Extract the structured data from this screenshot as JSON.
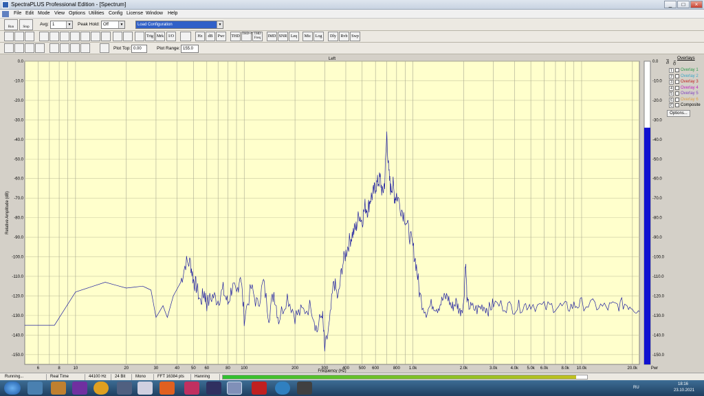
{
  "window": {
    "title": "SpectraPLUS Professional Edition - [Spectrum]",
    "minimize": "_",
    "maximize": "□",
    "close": "×"
  },
  "menu": [
    "File",
    "Edit",
    "Mode",
    "View",
    "Options",
    "Utilities",
    "Config",
    "License",
    "Window",
    "Help"
  ],
  "toolbar1": {
    "run": "Run",
    "stop": "Stop",
    "avg_label": "Avg:",
    "avg_value": "1",
    "peakhold_label": "Peak Hold:",
    "peakhold_value": "Off",
    "config_value": "Load Configuration"
  },
  "toolbar2": [
    "Trig",
    "Mrk",
    "I/O",
    "Hz",
    "dB",
    "Pwr",
    "THD",
    "THD+N",
    "THD Freq",
    "IMD",
    "SNR",
    "Leq",
    "Mic",
    "Log",
    "Dly",
    "Rvb",
    "Swp"
  ],
  "toolbar3": {
    "plottop_label": "Plot Top:",
    "plottop_value": "0.00",
    "plotrange_label": "Plot Range:",
    "plotrange_value": "155.0"
  },
  "plot": {
    "channel": "Left",
    "xlabel": "Frequency (Hz)",
    "ylabel": "Relative Amplitude (dB)"
  },
  "chart_data": {
    "type": "line",
    "title": "Left",
    "xlabel": "Frequency (Hz)",
    "ylabel": "Relative Amplitude (dB)",
    "xscale": "log",
    "xlim": [
      5,
      22000
    ],
    "ylim": [
      -155,
      0
    ],
    "grid": true,
    "yticks": [
      "0.0",
      "-10.0",
      "-20.0",
      "-30.0",
      "-40.0",
      "-50.0",
      "-60.0",
      "-70.0",
      "-80.0",
      "-90.0",
      "-100.0",
      "-110.0",
      "-120.0",
      "-130.0",
      "-140.0",
      "-150.0"
    ],
    "xticks": [
      {
        "v": 6,
        "t": "6"
      },
      {
        "v": 8,
        "t": "8"
      },
      {
        "v": 10,
        "t": "10"
      },
      {
        "v": 20,
        "t": "20"
      },
      {
        "v": 30,
        "t": "30"
      },
      {
        "v": 40,
        "t": "40"
      },
      {
        "v": 50,
        "t": "50"
      },
      {
        "v": 60,
        "t": "60"
      },
      {
        "v": 80,
        "t": "80"
      },
      {
        "v": 100,
        "t": "100"
      },
      {
        "v": 200,
        "t": "200"
      },
      {
        "v": 300,
        "t": "300"
      },
      {
        "v": 400,
        "t": "400"
      },
      {
        "v": 500,
        "t": "500"
      },
      {
        "v": 600,
        "t": "600"
      },
      {
        "v": 800,
        "t": "800"
      },
      {
        "v": 1000,
        "t": "1.0k"
      },
      {
        "v": 2000,
        "t": "2.0k"
      },
      {
        "v": 3000,
        "t": "3.0k"
      },
      {
        "v": 4000,
        "t": "4.0k"
      },
      {
        "v": 5000,
        "t": "5.0k"
      },
      {
        "v": 6000,
        "t": "6.0k"
      },
      {
        "v": 8000,
        "t": "8.0k"
      },
      {
        "v": 10000,
        "t": "10.0k"
      },
      {
        "v": 20000,
        "t": "20.0k"
      }
    ],
    "series": [
      {
        "color": "#2020a0",
        "x": [
          5,
          7.5,
          10,
          15,
          20,
          25,
          28,
          30,
          33,
          35,
          38,
          42,
          45,
          48,
          50,
          52,
          55,
          58,
          60,
          65,
          70,
          75,
          80,
          85,
          90,
          95,
          100,
          110,
          120,
          130,
          140,
          150,
          160,
          180,
          200,
          220,
          250,
          270,
          290,
          300,
          320,
          340,
          360,
          380,
          400,
          420,
          440,
          460,
          480,
          500,
          520,
          540,
          560,
          580,
          600,
          620,
          640,
          660,
          680,
          700,
          720,
          740,
          760,
          780,
          800,
          850,
          900,
          950,
          1000,
          1050,
          1100,
          1200,
          1300,
          1400,
          1500,
          1600,
          1700,
          1800,
          1900,
          2000,
          2050,
          2100,
          2200,
          2400,
          2600,
          2800,
          3000,
          3500,
          4000,
          4500,
          5000,
          6000,
          7000,
          8000,
          9000,
          10000,
          12000,
          14000,
          16000,
          18000,
          20000,
          22000
        ],
        "y": [
          -135,
          -135,
          -118,
          -113,
          -116,
          -115,
          -117,
          -131,
          -125,
          -131,
          -120,
          -113,
          -103,
          -103,
          -112,
          -115,
          -123,
          -118,
          -124,
          -120,
          -122,
          -117,
          -124,
          -115,
          -120,
          -108,
          -131,
          -116,
          -125,
          -113,
          -130,
          -118,
          -132,
          -120,
          -130,
          -128,
          -125,
          -138,
          -128,
          -148,
          -135,
          -112,
          -122,
          -105,
          -98,
          -92,
          -88,
          -85,
          -78,
          -82,
          -74,
          -76,
          -70,
          -68,
          -64,
          -62,
          -60,
          -68,
          -62,
          -37,
          -58,
          -66,
          -62,
          -70,
          -68,
          -75,
          -80,
          -88,
          -95,
          -105,
          -120,
          -128,
          -124,
          -126,
          -122,
          -120,
          -126,
          -123,
          -128,
          -124,
          -102,
          -124,
          -126,
          -127,
          -125,
          -127,
          -124,
          -125,
          -126,
          -125,
          -124,
          -126,
          -125,
          -126,
          -125,
          -124,
          -125,
          -126,
          -125,
          -124,
          -125,
          -128
        ]
      }
    ]
  },
  "meter": {
    "label": "Pwr",
    "level_db": -34,
    "ticks": [
      "0.0",
      "-10.0",
      "-20.0",
      "-30.0",
      "-40.0",
      "-50.0",
      "-60.0",
      "-70.0",
      "-80.0",
      "-90.0",
      "-100.0",
      "-110.0",
      "-120.0",
      "-130.0",
      "-140.0",
      "-150.0"
    ]
  },
  "overlays": {
    "title": "Overlays",
    "sel": "Sel",
    "on": "On",
    "items": [
      {
        "n": "1",
        "name": "Overlay 1",
        "color": "#2a9a4a"
      },
      {
        "n": "2",
        "name": "Overlay 2",
        "color": "#3aa8c8"
      },
      {
        "n": "3",
        "name": "Overlay 3",
        "color": "#c02020"
      },
      {
        "n": "4",
        "name": "Overlay 4",
        "color": "#c020c0"
      },
      {
        "n": "5",
        "name": "Overlay 5",
        "color": "#8040c0"
      },
      {
        "n": "6",
        "name": "Overlay 6",
        "color": "#e0a040"
      },
      {
        "n": "C",
        "name": "Composite",
        "color": "#000000"
      }
    ],
    "options": "Options..."
  },
  "status": {
    "state": "Running...",
    "mode": "Real Time",
    "rate": "44100 Hz",
    "bits": "24 Bit",
    "chan": "Mono",
    "fft": "FFT 16384 pts",
    "window": "Hanning",
    "progress": 0.97
  },
  "taskbar": {
    "lang": "RU",
    "time": "18:16",
    "date": "23.10.2021"
  }
}
